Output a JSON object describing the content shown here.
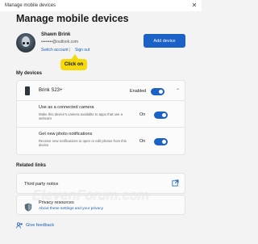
{
  "window": {
    "title": "Manage mobile devices",
    "close_glyph": "✕"
  },
  "page": {
    "title": "Manage mobile devices"
  },
  "account": {
    "name": "Shawn Brink",
    "email": "••••••••@outlook.com",
    "switch_label": "Switch account",
    "separator": "|",
    "signout_label": "Sign out"
  },
  "add_device_label": "Add device",
  "callout": {
    "label": "Click on",
    "color": "#f5d90a"
  },
  "my_devices": {
    "heading": "My devices",
    "device": {
      "name": "Brink S23+",
      "state": "Enabled",
      "enabled": true
    },
    "settings": [
      {
        "title": "Use as a connected camera",
        "desc": "Make this device's camera available to apps that use a webcam",
        "state": "On",
        "on": true
      },
      {
        "title": "Get new photo notifications",
        "desc": "Receive new notifications to open or edit photos from this device",
        "state": "On",
        "on": true
      }
    ]
  },
  "related": {
    "heading": "Related links",
    "third_party": "Third party notice",
    "privacy_title": "Privacy resources",
    "privacy_link": "About these settings and your privacy"
  },
  "feedback_label": "Give feedback",
  "watermark": "ElevenForum.com",
  "colors": {
    "accent": "#1c61c5",
    "link": "#1a5fb4",
    "background": "#f3f3f3"
  },
  "icons": {
    "avatar": "alien-avatar",
    "device": "phone-icon",
    "external": "external-link-icon",
    "privacy": "shield-icon",
    "feedback": "feedback-icon",
    "expand": "chevron-up-icon"
  }
}
